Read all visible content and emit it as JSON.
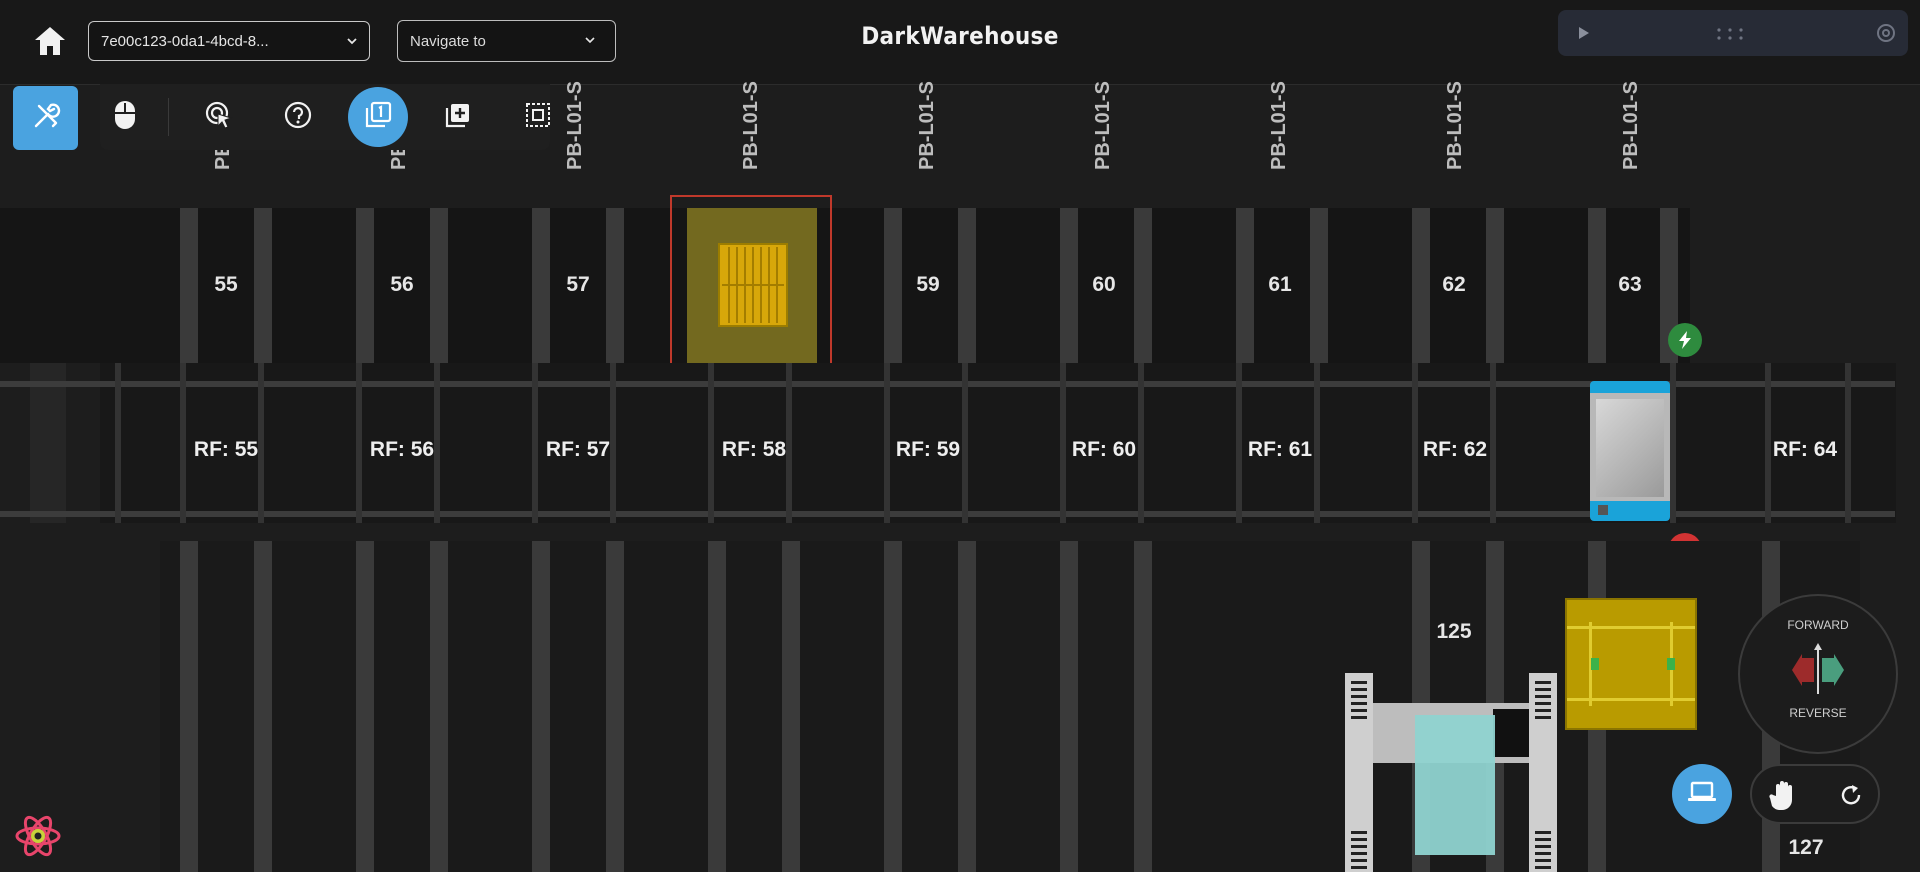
{
  "header": {
    "session_select_value": "7e00c123-0da1-4bcd-8...",
    "navigate_placeholder": "Navigate to",
    "title": "DarkWarehouse"
  },
  "toolbar": {
    "tools": [
      "settings-tools",
      "mouse",
      "target-cursor",
      "help",
      "layer-1",
      "add-item",
      "select-area"
    ],
    "active": "layer-1"
  },
  "floor": {
    "column_labels": [
      "PE",
      "PE",
      "PB-L01-S",
      "PB-L01-S",
      "PB-L01-S",
      "PB-L01-S",
      "PB-L01-S",
      "PB-L01-S",
      "PB-L01-S"
    ],
    "slots": [
      "55",
      "56",
      "57",
      "59",
      "60",
      "61",
      "62",
      "63"
    ],
    "rf_labels": [
      "RF: 55",
      "RF: 56",
      "RF: 57",
      "RF: 58",
      "RF: 59",
      "RF: 60",
      "RF: 61",
      "RF: 62",
      "RF: 64"
    ],
    "lower_slots": [
      "125",
      "127"
    ]
  },
  "direction": {
    "forward": "FORWARD",
    "reverse": "REVERSE"
  },
  "colors": {
    "accent": "#4aa3e0",
    "selected_border": "#c0392b",
    "pallet": "#c9a800",
    "charge_ok": "#2e8b3e",
    "charge_alert": "#d23333",
    "robot_top": "#1aa3d9",
    "cart_cyan": "#8fd3d0"
  }
}
